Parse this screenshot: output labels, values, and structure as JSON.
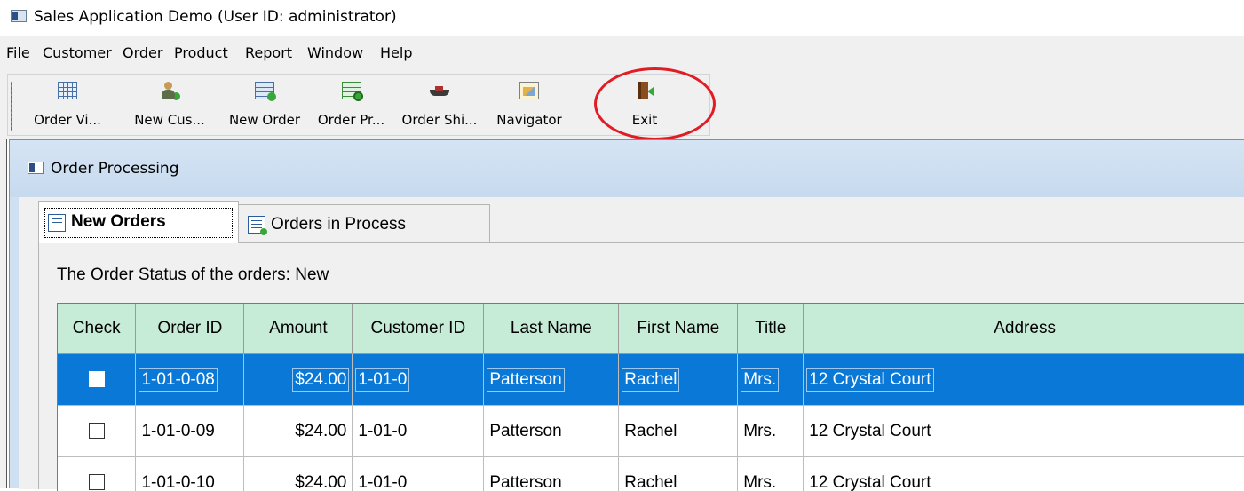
{
  "window": {
    "title": "Sales Application Demo (User ID: administrator)",
    "icon": "app-window-icon"
  },
  "menu": {
    "items": [
      "File",
      "Customer",
      "Order",
      "Product",
      "Report",
      "Window",
      "Help"
    ]
  },
  "toolbar": {
    "buttons": [
      {
        "label": "Order Vi...",
        "icon": "order-view-icon"
      },
      {
        "label": "New Cus...",
        "icon": "new-customer-icon"
      },
      {
        "label": "New Order",
        "icon": "new-order-icon"
      },
      {
        "label": "Order Pr...",
        "icon": "order-processing-icon"
      },
      {
        "label": "Order Shi...",
        "icon": "order-shipping-icon"
      },
      {
        "label": "Navigator",
        "icon": "navigator-icon"
      },
      {
        "label": "Exit",
        "icon": "exit-icon"
      }
    ],
    "highlight_color": "#e01c24"
  },
  "child_window": {
    "title": "Order Processing",
    "tabs": [
      {
        "label": "New Orders",
        "active": true
      },
      {
        "label": "Orders in Process",
        "active": false
      }
    ],
    "status_text": "The Order Status of the orders: New",
    "grid": {
      "columns": [
        "Check",
        "Order ID",
        "Amount",
        "Customer ID",
        "Last Name",
        "First Name",
        "Title",
        "Address"
      ],
      "rows": [
        {
          "check": false,
          "order_id": "1-01-0-08",
          "amount": "$24.00",
          "customer_id": "1-01-0",
          "last_name": "Patterson",
          "first_name": "Rachel",
          "title": "Mrs.",
          "address": "12 Crystal Court",
          "selected": true
        },
        {
          "check": false,
          "order_id": "1-01-0-09",
          "amount": "$24.00",
          "customer_id": "1-01-0",
          "last_name": "Patterson",
          "first_name": "Rachel",
          "title": "Mrs.",
          "address": "12 Crystal Court",
          "selected": false
        },
        {
          "check": false,
          "order_id": "1-01-0-10",
          "amount": "$24.00",
          "customer_id": "1-01-0",
          "last_name": "Patterson",
          "first_name": "Rachel",
          "title": "Mrs.",
          "address": "12 Crystal Court",
          "selected": false
        }
      ],
      "header_color": "#c6ecd8",
      "selection_color": "#0a78d7"
    }
  }
}
